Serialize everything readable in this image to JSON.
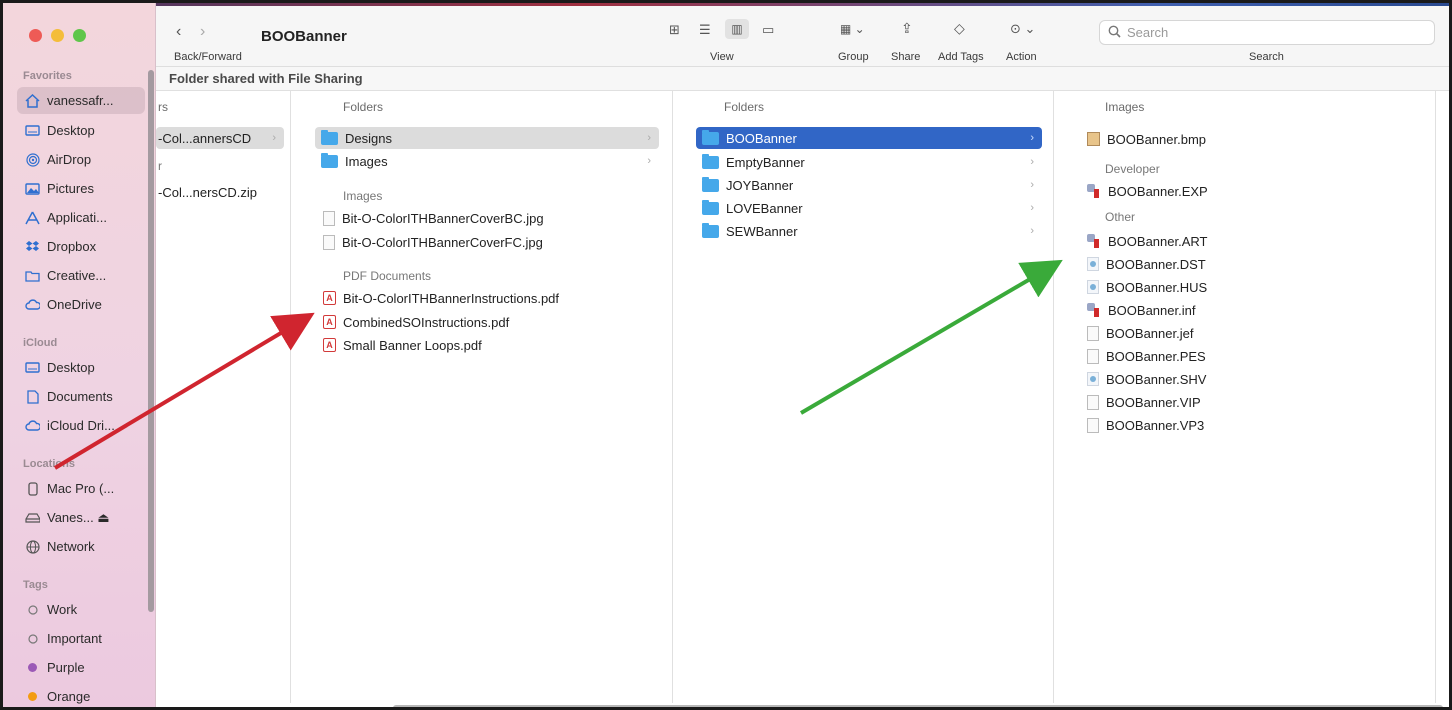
{
  "window": {
    "title": "BOOBanner",
    "path_label": "Folder shared with File Sharing"
  },
  "toolbar": {
    "nav_label": "Back/Forward",
    "view_label": "View",
    "group_label": "Group",
    "share_label": "Share",
    "add_tags_label": "Add Tags",
    "action_label": "Action",
    "search_label": "Search",
    "search_placeholder": "Search"
  },
  "sidebar": {
    "favorites_header": "Favorites",
    "favorites": [
      {
        "label": "vanessafr...",
        "icon": "home-icon"
      },
      {
        "label": "Desktop",
        "icon": "desktop-icon"
      },
      {
        "label": "AirDrop",
        "icon": "airdrop-icon"
      },
      {
        "label": "Pictures",
        "icon": "pictures-icon"
      },
      {
        "label": "Applicati...",
        "icon": "applications-icon"
      },
      {
        "label": "Dropbox",
        "icon": "dropbox-icon"
      },
      {
        "label": "Creative...",
        "icon": "folder-icon"
      },
      {
        "label": "OneDrive",
        "icon": "cloud-icon"
      }
    ],
    "icloud_header": "iCloud",
    "icloud": [
      {
        "label": "Desktop",
        "icon": "desktop-icon"
      },
      {
        "label": "Documents",
        "icon": "document-icon"
      },
      {
        "label": "iCloud Dri...",
        "icon": "cloud-icon"
      }
    ],
    "locations_header": "Locations",
    "locations": [
      {
        "label": "Mac Pro (...",
        "icon": "computer-icon"
      },
      {
        "label": "Vanes... ⏏",
        "icon": "drive-icon"
      },
      {
        "label": "Network",
        "icon": "globe-icon"
      }
    ],
    "tags_header": "Tags",
    "tags": [
      {
        "label": "Work",
        "color": ""
      },
      {
        "label": "Important",
        "color": ""
      },
      {
        "label": "Purple",
        "color": "#9b59b6"
      },
      {
        "label": "Orange",
        "color": "#f39c12"
      }
    ]
  },
  "columns": {
    "col1": {
      "header": "rs",
      "row1": "-Col...annersCD",
      "sub_header": "r",
      "row2": "-Col...nersCD.zip"
    },
    "col2": {
      "header": "Folders",
      "folders": [
        "Designs",
        "Images"
      ],
      "images_header": "Images",
      "images": [
        "Bit-O-ColorITHBannerCoverBC.jpg",
        "Bit-O-ColorITHBannerCoverFC.jpg"
      ],
      "pdf_header": "PDF Documents",
      "pdfs": [
        "Bit-O-ColorITHBannerInstructions.pdf",
        "CombinedSOInstructions.pdf",
        "Small Banner Loops.pdf"
      ]
    },
    "col3": {
      "header": "Folders",
      "folders": [
        "BOOBanner",
        "EmptyBanner",
        "JOYBanner",
        "LOVEBanner",
        "SEWBanner"
      ]
    },
    "col4": {
      "header": "Images",
      "images": [
        "BOOBanner.bmp"
      ],
      "developer_header": "Developer",
      "developer": [
        "BOOBanner.EXP"
      ],
      "other_header": "Other",
      "other": [
        "BOOBanner.ART",
        "BOOBanner.DST",
        "BOOBanner.HUS",
        "BOOBanner.inf",
        "BOOBanner.jef",
        "BOOBanner.PES",
        "BOOBanner.SHV",
        "BOOBanner.VIP",
        "BOOBanner.VP3"
      ]
    }
  },
  "colors": {
    "selection_blue": "#3166c6",
    "folder_blue": "#45a8ea",
    "arrow_red": "#d0252f",
    "arrow_green": "#3aaa3a"
  }
}
